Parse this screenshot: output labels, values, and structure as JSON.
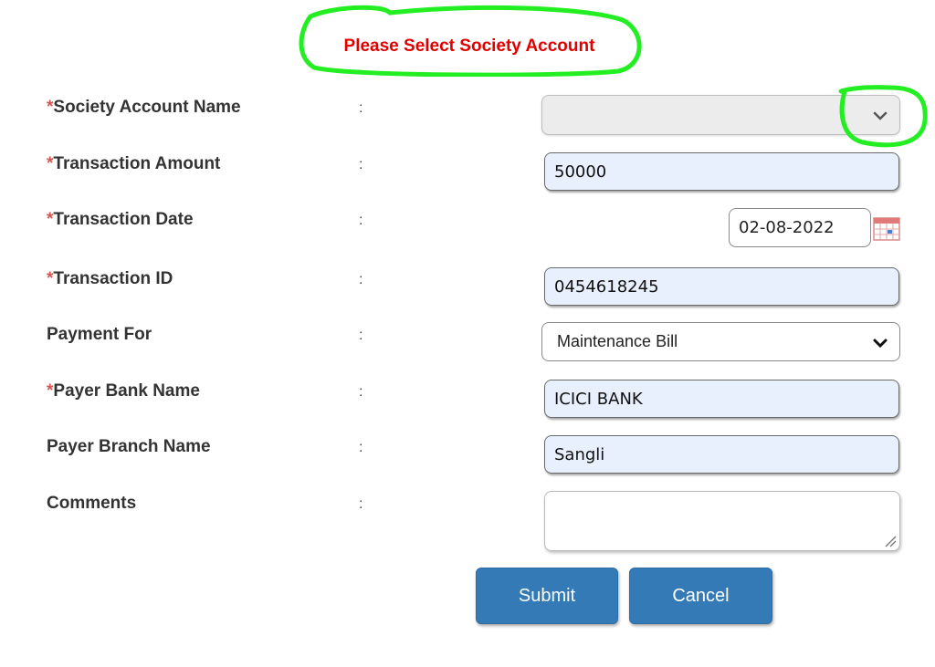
{
  "alert": {
    "text": "Please Select Society Account"
  },
  "form": {
    "rows": [
      {
        "required": "*",
        "label": "Society Account Name",
        "colon": ":"
      },
      {
        "required": "*",
        "label": "Transaction Amount",
        "colon": ":"
      },
      {
        "required": "*",
        "label": "Transaction Date",
        "colon": ":"
      },
      {
        "required": "*",
        "label": "Transaction ID",
        "colon": ":"
      },
      {
        "required": "",
        "label": "Payment For",
        "colon": ":"
      },
      {
        "required": "*",
        "label": "Payer Bank Name",
        "colon": ":"
      },
      {
        "required": "",
        "label": "Payer Branch Name",
        "colon": ":"
      },
      {
        "required": "",
        "label": "Comments",
        "colon": ":"
      }
    ],
    "society_account": {
      "value": ""
    },
    "transaction_amount": {
      "value": "50000"
    },
    "transaction_date": {
      "value": "02-08-2022"
    },
    "transaction_id": {
      "value": "0454618245"
    },
    "payment_for": {
      "value": "Maintenance Bill"
    },
    "payer_bank": {
      "value": "ICICI BANK"
    },
    "payer_branch": {
      "value": "Sangli"
    },
    "comments": {
      "value": ""
    }
  },
  "buttons": {
    "submit": "Submit",
    "cancel": "Cancel"
  },
  "colors": {
    "alert_text": "#e00000",
    "highlight_circle": "#22ee22",
    "button_bg": "#337ab7",
    "autofill_bg": "#e8f0fe",
    "required_star": "#d9534f"
  },
  "icons": [
    "chevron-down-icon",
    "calendar-icon",
    "resize-handle-icon"
  ]
}
